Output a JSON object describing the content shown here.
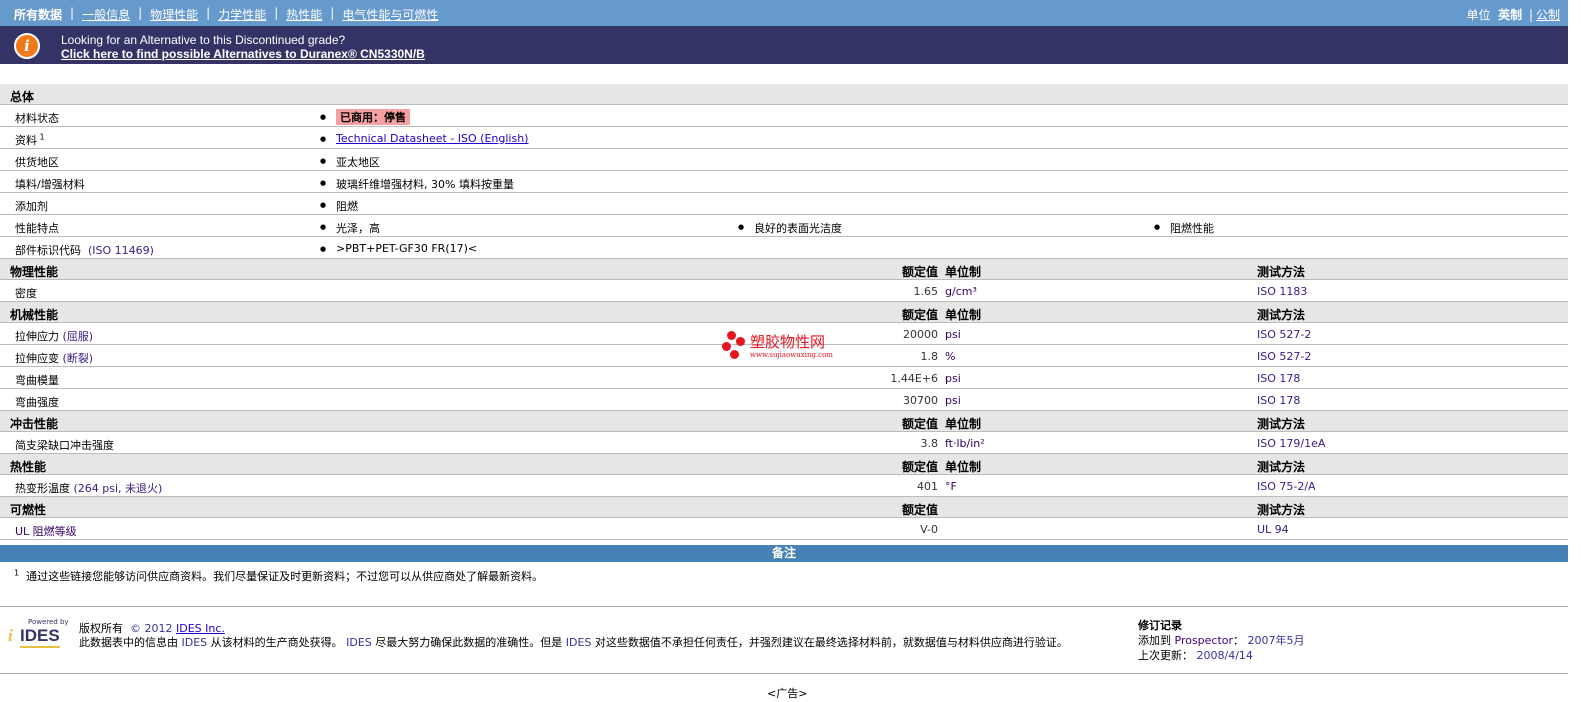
{
  "nav": {
    "tabs": [
      "所有数据",
      "一般信息",
      "物理性能",
      "力学性能",
      "热性能",
      "电气性能与可燃性"
    ],
    "units_label": "单位",
    "units_imperial": "英制",
    "units_metric": "公制"
  },
  "banner": {
    "line1": "Looking for an Alternative to this Discontinued grade?",
    "line2": "Click here to find possible Alternatives to Duranex® CN5330N/B",
    "icon": "info-icon"
  },
  "general": {
    "title": "总体",
    "rows": [
      {
        "label": "材料状态",
        "values": [
          "已商用：停售"
        ],
        "type": "status"
      },
      {
        "label": "资料",
        "sup": "1",
        "values": [
          "Technical Datasheet - ISO (English)"
        ],
        "type": "link"
      },
      {
        "label": "供货地区",
        "values": [
          "亚太地区"
        ]
      },
      {
        "label": "填料/增强材料",
        "values": [
          "玻璃纤维增强材料, 30% 填料按重量"
        ]
      },
      {
        "label": "添加剂",
        "values": [
          "阻燃"
        ]
      },
      {
        "label": "性能特点",
        "values": [
          "光泽，高",
          "良好的表面光洁度",
          "阻燃性能"
        ]
      },
      {
        "label": "部件标识代码",
        "paren": "(ISO 11469)",
        "values": [
          ">PBT+PET-GF30 FR(17)<"
        ]
      }
    ]
  },
  "columns": {
    "value": "额定值",
    "unit": "单位制",
    "method": "测试方法"
  },
  "sections": [
    {
      "title": "物理性能",
      "rows": [
        {
          "label": "密度",
          "value": "1.65",
          "unit": "g/cm³",
          "method": "ISO 1183"
        }
      ]
    },
    {
      "title": "机械性能",
      "rows": [
        {
          "label": "拉伸应力",
          "paren": "(屈服)",
          "value": "20000",
          "unit": "psi",
          "method": "ISO 527-2"
        },
        {
          "label": "拉伸应变",
          "paren": "(断裂)",
          "value": "1.8",
          "unit": "%",
          "method": "ISO 527-2"
        },
        {
          "label": "弯曲模量",
          "value": "1.44E+6",
          "unit": "psi",
          "method": "ISO 178"
        },
        {
          "label": "弯曲强度",
          "value": "30700",
          "unit": "psi",
          "method": "ISO 178"
        }
      ]
    },
    {
      "title": "冲击性能",
      "rows": [
        {
          "label": "简支梁缺口冲击强度",
          "value": "3.8",
          "unit": "ft·lb/in²",
          "method": "ISO 179/1eA"
        }
      ]
    },
    {
      "title": "热性能",
      "rows": [
        {
          "label": "热变形温度",
          "paren": "(264 psi, 未退火)",
          "value": "401",
          "unit": "°F",
          "method": "ISO 75-2/A"
        }
      ]
    },
    {
      "title": "可燃性",
      "nounit": true,
      "rows": [
        {
          "label": "UL 阻燃等级",
          "value": "V-0",
          "unit": "",
          "method": "UL 94"
        }
      ]
    }
  ],
  "notes": {
    "title": "备注",
    "sup": "1",
    "text": "通过这些链接您能够访问供应商资料。我们尽量保证及时更新资料；不过您可以从供应商处了解最新资料。"
  },
  "footer": {
    "logo_powered": "Powered by",
    "logo_name": "IDES",
    "copyright": "版权所有",
    "year": "© 2012",
    "company": "IDES Inc.",
    "disclaimer_parts": [
      "此数据表中的信息由",
      "IDES",
      "从该材料的生产商处获得。",
      "IDES",
      "尽最大努力确保此数据的准确性。但是",
      "IDES",
      "对这些数据值不承担任何责任，并强烈建议在最终选择材料前，就数据值与材料供应商进行验证。"
    ],
    "revision_title": "修订记录",
    "added_label": "添加到",
    "added_src": "Prospector",
    "added_date": "2007年5月",
    "updated_label": "上次更新：",
    "updated_date": "2008/4/14"
  },
  "ad": "<广告>",
  "watermark": {
    "name": "塑胶物性网",
    "url": "www.sujiaowuxing.com"
  }
}
